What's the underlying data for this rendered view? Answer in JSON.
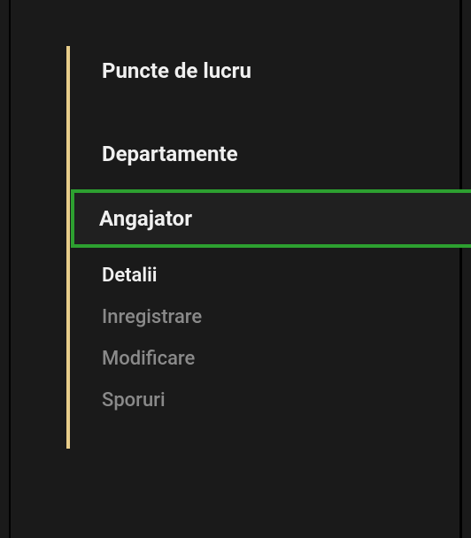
{
  "sidebar": {
    "items": [
      {
        "label": "Puncte de lucru"
      },
      {
        "label": "Departamente"
      },
      {
        "label": "Angajator"
      }
    ],
    "subitems": [
      {
        "label": "Detalii"
      },
      {
        "label": "Inregistrare"
      },
      {
        "label": "Modificare"
      },
      {
        "label": "Sporuri"
      }
    ]
  }
}
